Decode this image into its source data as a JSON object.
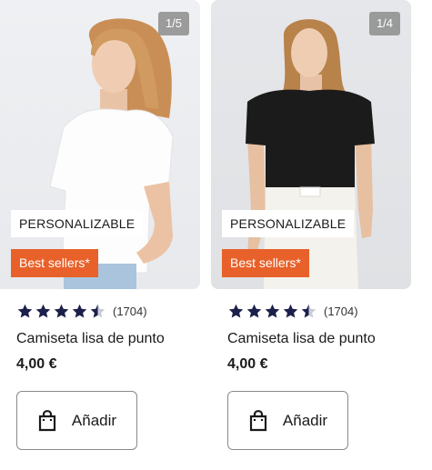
{
  "colors": {
    "badge_orange": "#e8612a",
    "star_fill": "#1c1f4a",
    "star_empty": "#c9cbd6"
  },
  "products": [
    {
      "image_counter": "1/5",
      "tag_personalizable": "PERSONALIZABLE",
      "tag_best_sellers": "Best sellers*",
      "rating": 4.5,
      "review_count": "(1704)",
      "title": "Camiseta lisa de punto",
      "price": "4,00 €",
      "add_label": "Añadir",
      "shirt_color": "white"
    },
    {
      "image_counter": "1/4",
      "tag_personalizable": "PERSONALIZABLE",
      "tag_best_sellers": "Best sellers*",
      "rating": 4.5,
      "review_count": "(1704)",
      "title": "Camiseta lisa de punto",
      "price": "4,00 €",
      "add_label": "Añadir",
      "shirt_color": "black"
    }
  ]
}
